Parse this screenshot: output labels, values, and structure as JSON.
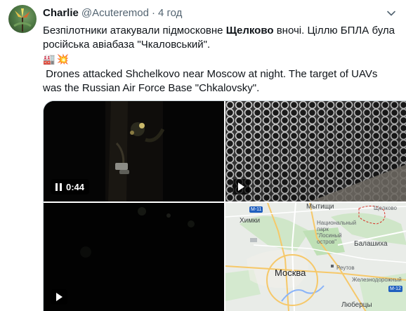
{
  "author": {
    "name": "Charlie",
    "handle": "@Acuteremod",
    "separator": "·",
    "time": "4 год"
  },
  "tweet": {
    "uk_prefix": "Безпілотники атакували підмосковне ",
    "uk_bold": "Щелково",
    "uk_suffix": " вночі. Ціллю БПЛА була російська авіабаза \"Чкаловський\".",
    "emoji_1": "🏭",
    "emoji_2": "💥",
    "en_text": "Drones attacked Shchelkovo near Moscow at night. The target of UAVs was the Russian Air Force Base \"Chkalovsky\"."
  },
  "media": {
    "video_1": {
      "duration": "0:44",
      "state_icon": "pause-icon"
    },
    "video_2": {
      "state_icon": "play-icon"
    },
    "video_3": {
      "state_icon": "play-icon"
    },
    "map": {
      "labels": {
        "mytishchi": "Мытищи",
        "schelkovo": "Щелково",
        "khimki": "Химки",
        "park": "Национальный парк \"Лосиный остров\"",
        "balashikha": "Балашиха",
        "moscow": "Москва",
        "reutov": "Реутов",
        "zheleznodorozhny": "Железнодорожный",
        "lyubertsy": "Люберцы"
      },
      "shields": {
        "m11": "M-11",
        "m12": "M-12"
      }
    }
  },
  "colors": {
    "text": "#0f1419",
    "secondary": "#536471",
    "border": "#cfd9de"
  }
}
